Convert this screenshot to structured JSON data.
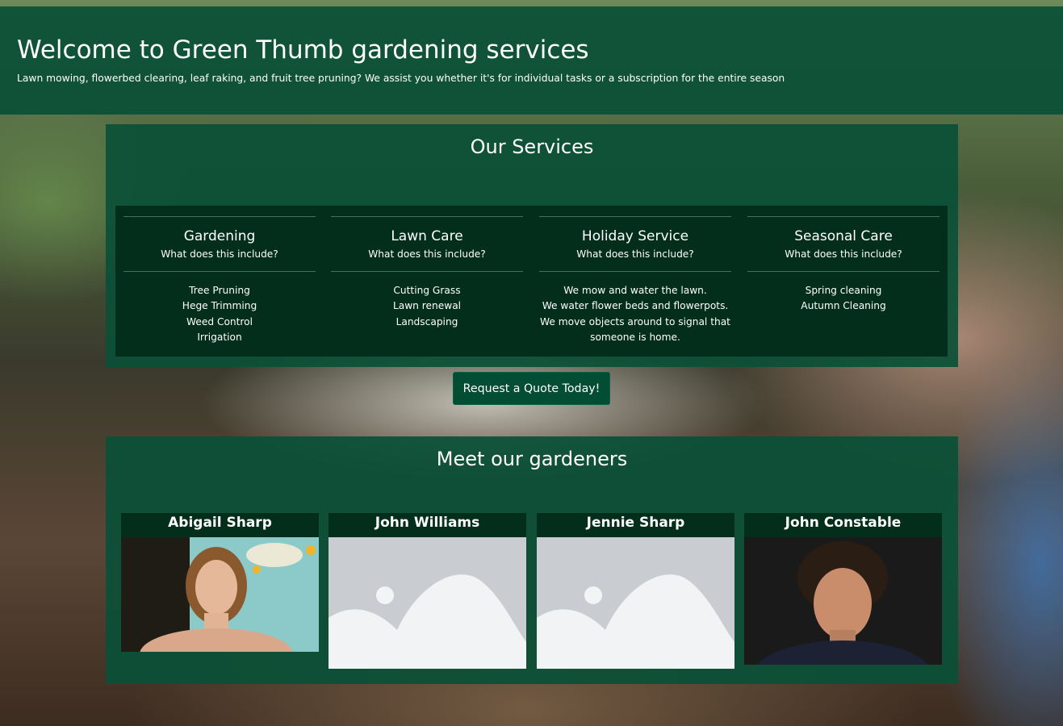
{
  "header": {
    "title": "Welcome to Green Thumb gardening services",
    "subtitle": "Lawn mowing, flowerbed clearing, leaf raking, and fruit tree pruning? We assist you whether it's for individual tasks or a subscription for the entire season"
  },
  "services": {
    "heading": "Our Services",
    "items": [
      {
        "title": "Gardening",
        "subtitle": "What does this include?",
        "lines": [
          "Tree Pruning",
          "Hege Trimming",
          "Weed Control",
          "Irrigation"
        ]
      },
      {
        "title": "Lawn Care",
        "subtitle": "What does this include?",
        "lines": [
          "Cutting Grass",
          "Lawn renewal",
          "Landscaping"
        ]
      },
      {
        "title": "Holiday Service",
        "subtitle": "What does this include?",
        "lines": [
          "We mow and water the lawn.",
          "We water flower beds and flowerpots.",
          "We move objects around to signal that",
          "someone is home."
        ]
      },
      {
        "title": "Seasonal Care",
        "subtitle": "What does this include?",
        "lines": [
          "Spring cleaning",
          "Autumn Cleaning"
        ]
      }
    ]
  },
  "cta": {
    "label": "Request a Quote Today!"
  },
  "gardeners": {
    "heading": "Meet our gardeners",
    "people": [
      {
        "name": "Abigail Sharp",
        "image": "portrait-photo"
      },
      {
        "name": "John Williams",
        "image": "image-placeholder-icon"
      },
      {
        "name": "Jennie Sharp",
        "image": "image-placeholder-icon"
      },
      {
        "name": "John Constable",
        "image": "portrait-photo"
      }
    ]
  }
}
